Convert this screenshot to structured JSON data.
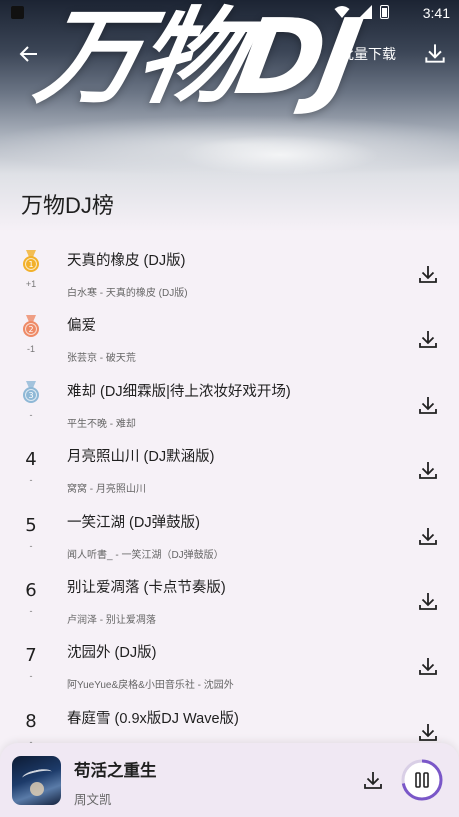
{
  "status_bar": {
    "time": "3:41"
  },
  "header": {
    "logo_text": "万物DJ",
    "batch_download_label": "批量下载",
    "page_title": "万物DJ榜"
  },
  "colors": {
    "gold": "#f2b12b",
    "silver_medal_orange": "#ee8a66",
    "bronze_blue": "#8fb8d6",
    "progress": "#7a57c8",
    "icon": "#222222"
  },
  "songs": [
    {
      "rank": "1",
      "change": "+1",
      "medal": "gold",
      "title": "天真的橡皮 (DJ版)",
      "subtitle": "白水寒 - 天真的橡皮 (DJ版)"
    },
    {
      "rank": "2",
      "change": "-1",
      "medal": "orange",
      "title": "偏爱",
      "subtitle": "张芸京 - 破天荒"
    },
    {
      "rank": "3",
      "change": "-",
      "medal": "blue",
      "title": "难却 (DJ细霖版|待上浓妆好戏开场)",
      "subtitle": "平生不晚 - 难却"
    },
    {
      "rank": "4",
      "change": "-",
      "medal": "",
      "title": "月亮照山川 (DJ默涵版)",
      "subtitle": "窝窝 - 月亮照山川"
    },
    {
      "rank": "5",
      "change": "-",
      "medal": "",
      "title": "一笑江湖 (DJ弹鼓版)",
      "subtitle": "闻人听書_ - 一笑江湖（DJ弹鼓版）"
    },
    {
      "rank": "6",
      "change": "-",
      "medal": "",
      "title": "别让爱凋落 (卡点节奏版)",
      "subtitle": "卢润泽 - 别让爱凋落"
    },
    {
      "rank": "7",
      "change": "-",
      "medal": "",
      "title": "沈园外 (DJ版)",
      "subtitle": "阿YueYue&戾格&小田音乐社 - 沈园外"
    },
    {
      "rank": "8",
      "change": "-",
      "medal": "",
      "title": "春庭雪 (0.9x版DJ Wave版)",
      "subtitle": ""
    }
  ],
  "player": {
    "title": "苟活之重生",
    "artist": "周文凯",
    "progress": 0.72
  }
}
